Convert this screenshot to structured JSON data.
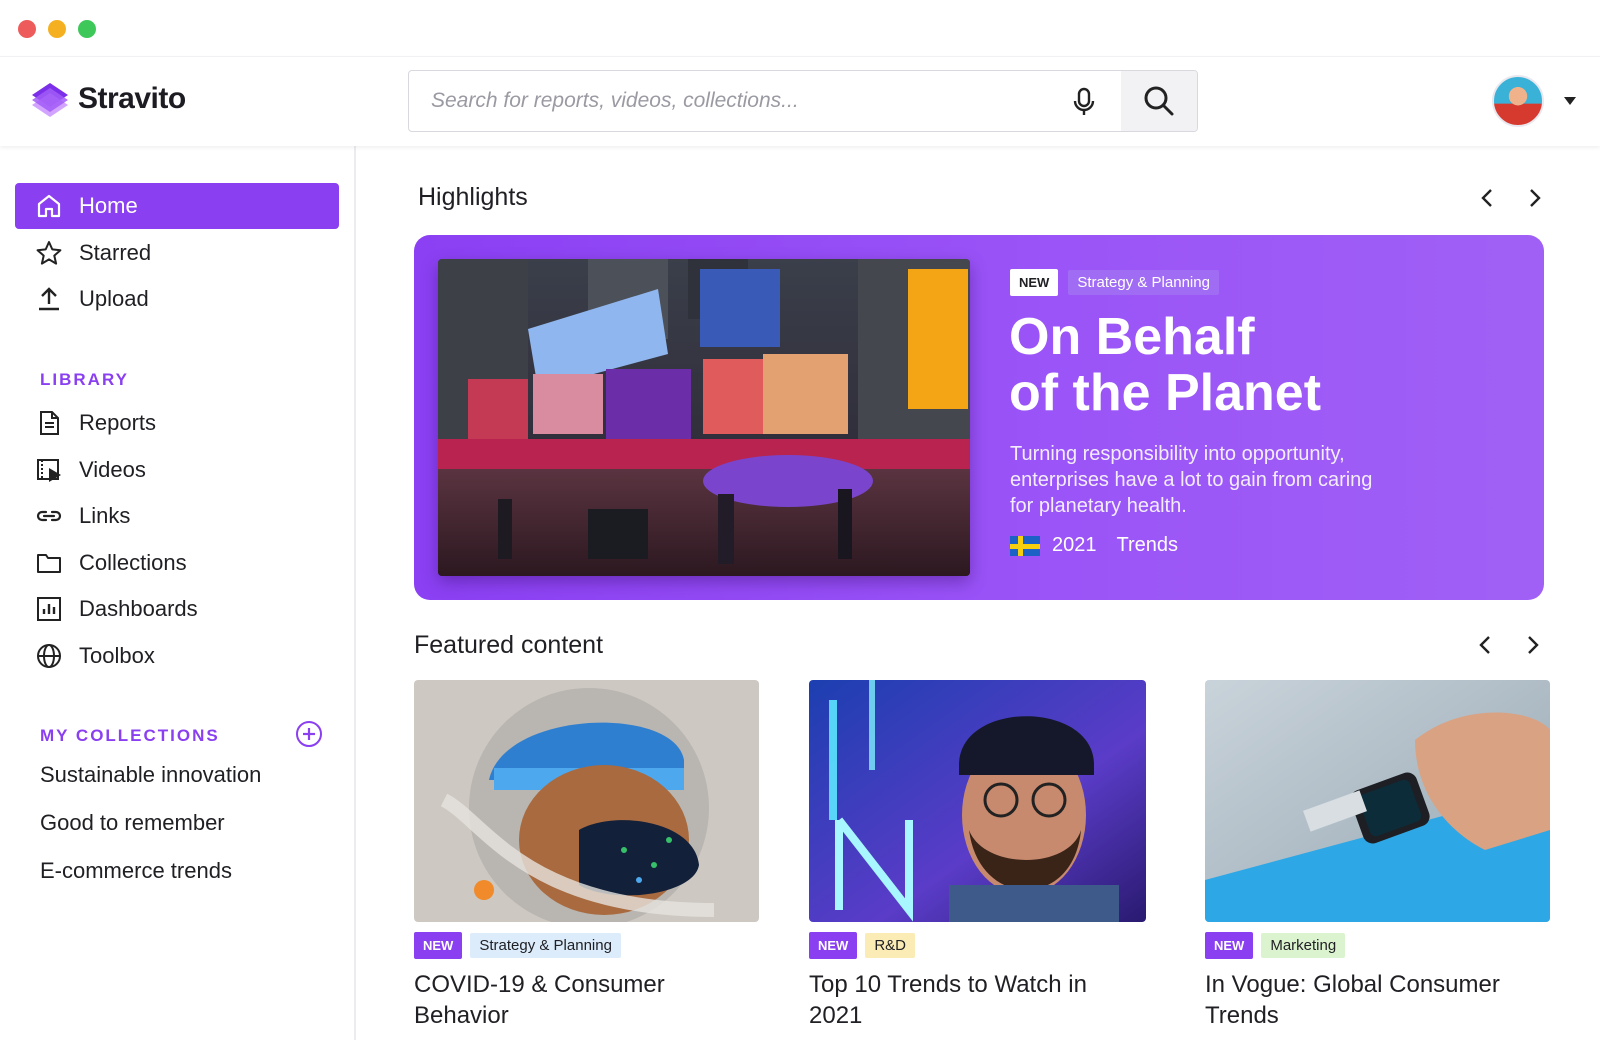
{
  "window": {
    "controls": [
      "close",
      "minimize",
      "maximize"
    ]
  },
  "header": {
    "brand": "Stravito",
    "search_placeholder": "Search for reports, videos, collections...",
    "mic_icon": "microphone-icon",
    "search_icon": "search-icon"
  },
  "sidebar": {
    "nav": [
      {
        "label": "Home",
        "icon": "home-icon",
        "active": true
      },
      {
        "label": "Starred",
        "icon": "star-icon"
      },
      {
        "label": "Upload",
        "icon": "upload-icon"
      }
    ],
    "library_label": "LIBRARY",
    "library": [
      {
        "label": "Reports",
        "icon": "document-icon"
      },
      {
        "label": "Videos",
        "icon": "video-icon"
      },
      {
        "label": "Links",
        "icon": "link-icon"
      },
      {
        "label": "Collections",
        "icon": "folder-icon"
      },
      {
        "label": "Dashboards",
        "icon": "dashboard-icon"
      },
      {
        "label": "Toolbox",
        "icon": "globe-icon"
      }
    ],
    "collections_label": "MY COLLECTIONS",
    "collections": [
      "Sustainable innovation",
      "Good to remember",
      "E-commerce trends"
    ]
  },
  "highlights": {
    "title": "Highlights",
    "hero": {
      "badge": "NEW",
      "category": "Strategy & Planning",
      "title_line1": "On Behalf",
      "title_line2": "of the Planet",
      "description": "Turning responsibility into opportunity, enterprises have a lot to gain from caring for planetary health.",
      "year": "2021",
      "type": "Trends"
    }
  },
  "featured": {
    "title": "Featured content",
    "cards": [
      {
        "badge": "NEW",
        "category": "Strategy & Planning",
        "category_color": "#dcecfb",
        "title": "COVID-19 & Consumer Behavior"
      },
      {
        "badge": "NEW",
        "category": "R&D",
        "category_color": "#fbecb6",
        "title": "Top 10 Trends to Watch in 2021"
      },
      {
        "badge": "NEW",
        "category": "Marketing",
        "category_color": "#dcf3cf",
        "title": "In Vogue: Global Consumer Trends"
      }
    ]
  },
  "colors": {
    "accent": "#8a3ff0",
    "hero_bg": "#9450f5"
  }
}
